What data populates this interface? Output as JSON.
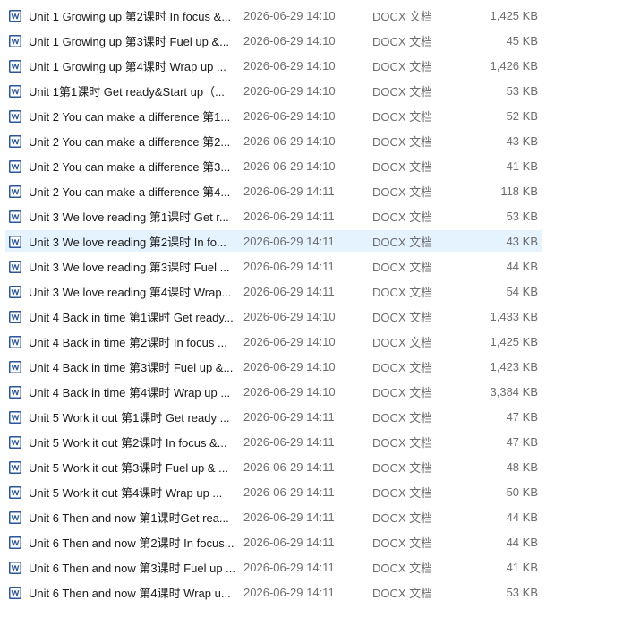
{
  "colors": {
    "word_icon": "#2b579a",
    "selected_row": "#e5f3ff",
    "secondary_text": "#6d6d6d"
  },
  "icon_name": "word-document-icon",
  "selected_index": 9,
  "files": [
    {
      "name": "Unit 1 Growing up 第2课时 In focus &...",
      "date": "2026-06-29 14:10",
      "type": "DOCX 文档",
      "size": "1,425 KB"
    },
    {
      "name": "Unit 1 Growing up 第3课时 Fuel up  &...",
      "date": "2026-06-29 14:10",
      "type": "DOCX 文档",
      "size": "45 KB"
    },
    {
      "name": "Unit 1 Growing up 第4课时 Wrap up ...",
      "date": "2026-06-29 14:10",
      "type": "DOCX 文档",
      "size": "1,426 KB"
    },
    {
      "name": "Unit 1第1课时 Get ready&Start up（...",
      "date": "2026-06-29 14:10",
      "type": "DOCX 文档",
      "size": "53 KB"
    },
    {
      "name": "Unit 2 You can make a difference 第1...",
      "date": "2026-06-29 14:10",
      "type": "DOCX 文档",
      "size": "52 KB"
    },
    {
      "name": "Unit 2 You can make a difference 第2...",
      "date": "2026-06-29 14:10",
      "type": "DOCX 文档",
      "size": "43 KB"
    },
    {
      "name": "Unit 2 You can make a difference 第3...",
      "date": "2026-06-29 14:10",
      "type": "DOCX 文档",
      "size": "41 KB"
    },
    {
      "name": "Unit 2 You can make a difference 第4...",
      "date": "2026-06-29 14:11",
      "type": "DOCX 文档",
      "size": "118 KB"
    },
    {
      "name": "Unit 3 We love reading 第1课时 Get r...",
      "date": "2026-06-29 14:11",
      "type": "DOCX 文档",
      "size": "53 KB"
    },
    {
      "name": "Unit 3 We love reading 第2课时 In fo...",
      "date": "2026-06-29 14:11",
      "type": "DOCX 文档",
      "size": "43 KB"
    },
    {
      "name": "Unit 3 We love reading 第3课时 Fuel ...",
      "date": "2026-06-29 14:11",
      "type": "DOCX 文档",
      "size": "44 KB"
    },
    {
      "name": "Unit 3 We love reading 第4课时 Wrap...",
      "date": "2026-06-29 14:11",
      "type": "DOCX 文档",
      "size": "54 KB"
    },
    {
      "name": "Unit 4 Back in time 第1课时 Get ready...",
      "date": "2026-06-29 14:10",
      "type": "DOCX 文档",
      "size": "1,433 KB"
    },
    {
      "name": "Unit 4 Back in time 第2课时 In focus ...",
      "date": "2026-06-29 14:10",
      "type": "DOCX 文档",
      "size": "1,425 KB"
    },
    {
      "name": "Unit 4 Back in time 第3课时 Fuel up &...",
      "date": "2026-06-29 14:10",
      "type": "DOCX 文档",
      "size": "1,423 KB"
    },
    {
      "name": "Unit 4 Back in time 第4课时 Wrap up ...",
      "date": "2026-06-29 14:10",
      "type": "DOCX 文档",
      "size": "3,384 KB"
    },
    {
      "name": "Unit 5 Work it out 第1课时 Get ready ...",
      "date": "2026-06-29 14:11",
      "type": "DOCX 文档",
      "size": "47 KB"
    },
    {
      "name": "Unit 5 Work it out 第2课时 In focus &...",
      "date": "2026-06-29 14:11",
      "type": "DOCX 文档",
      "size": "47 KB"
    },
    {
      "name": "Unit 5 Work it out 第3课时 Fuel up & ...",
      "date": "2026-06-29 14:11",
      "type": "DOCX 文档",
      "size": "48 KB"
    },
    {
      "name": "Unit 5 Work it out 第4课时 Wrap up ...",
      "date": "2026-06-29 14:11",
      "type": "DOCX 文档",
      "size": "50 KB"
    },
    {
      "name": "Unit 6 Then and now 第1课时Get rea...",
      "date": "2026-06-29 14:11",
      "type": "DOCX 文档",
      "size": "44 KB"
    },
    {
      "name": "Unit 6 Then and now 第2课时 In focus...",
      "date": "2026-06-29 14:11",
      "type": "DOCX 文档",
      "size": "44 KB"
    },
    {
      "name": "Unit 6 Then and now 第3课时 Fuel up ...",
      "date": "2026-06-29 14:11",
      "type": "DOCX 文档",
      "size": "41 KB"
    },
    {
      "name": "Unit 6 Then and now 第4课时 Wrap u...",
      "date": "2026-06-29 14:11",
      "type": "DOCX 文档",
      "size": "53 KB"
    }
  ]
}
